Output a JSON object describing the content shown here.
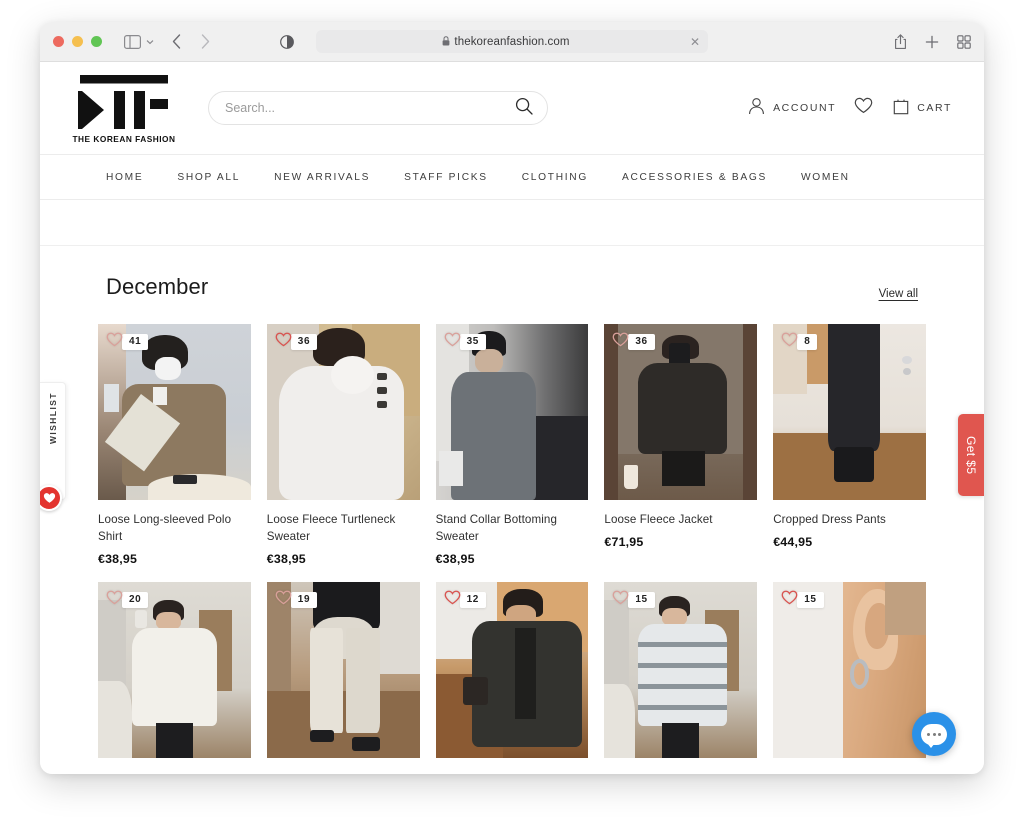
{
  "browser": {
    "traffic_lights": [
      "close",
      "minimize",
      "zoom"
    ],
    "url": "thekoreanfashion.com",
    "lock_icon": "lock-icon",
    "reader_icon": "reader-view-icon",
    "sidebar_icon": "sidebar-toggle-icon",
    "back_icon": "back-arrow-icon",
    "forward_icon": "forward-arrow-icon",
    "share_icon": "share-icon",
    "new_tab_icon": "plus-icon",
    "tab_overview_icon": "tab-grid-icon",
    "close_tab_icon": "close-icon"
  },
  "header": {
    "logo_text": "THE KOREAN FASHION",
    "logo_mark": "ktf-monogram-logo",
    "search": {
      "placeholder": "Search...",
      "value": "",
      "icon": "search-icon"
    },
    "account": {
      "label": "ACCOUNT",
      "icon": "user-icon"
    },
    "wishlist_icon": "heart-icon",
    "cart": {
      "label": "CART",
      "icon": "shopping-bag-icon"
    }
  },
  "nav": {
    "items": [
      {
        "label": "HOME"
      },
      {
        "label": "SHOP ALL"
      },
      {
        "label": "NEW ARRIVALS"
      },
      {
        "label": "STAFF PICKS"
      },
      {
        "label": "CLOTHING"
      },
      {
        "label": "ACCESSORIES & BAGS"
      },
      {
        "label": "WOMEN"
      }
    ]
  },
  "collection": {
    "title": "December",
    "view_all_label": "View all",
    "products": [
      {
        "title": "Loose Long-sleeved Polo Shirt",
        "price": "€38,95",
        "likes": "41",
        "scene": "polo-shirt-brown"
      },
      {
        "title": "Loose Fleece Turtleneck Sweater",
        "price": "€38,95",
        "likes": "36",
        "scene": "fleece-turtleneck-white"
      },
      {
        "title": "Stand Collar Bottoming Sweater",
        "price": "€38,95",
        "likes": "35",
        "scene": "stand-collar-grey"
      },
      {
        "title": "Loose Fleece Jacket",
        "price": "€71,95",
        "likes": "36",
        "scene": "fleece-jacket-black"
      },
      {
        "title": "Cropped Dress Pants",
        "price": "€44,95",
        "likes": "8",
        "scene": "cropped-pants-black"
      },
      {
        "title": "",
        "price": "",
        "likes": "20",
        "scene": "white-sweatshirt"
      },
      {
        "title": "",
        "price": "",
        "likes": "19",
        "scene": "cream-wide-pants"
      },
      {
        "title": "",
        "price": "",
        "likes": "12",
        "scene": "dark-puffer-jacket"
      },
      {
        "title": "",
        "price": "",
        "likes": "15",
        "scene": "plaid-puffer-jacket"
      },
      {
        "title": "",
        "price": "",
        "likes": "15",
        "scene": "hoop-earring"
      }
    ]
  },
  "widgets": {
    "wishlist_tab_label": "WISHLIST",
    "wishlist_tab_icon": "heart-icon",
    "get5_label": "Get $5",
    "chat_icon": "chat-bubble-icon"
  },
  "colors": {
    "accent_red": "#e3342f",
    "get5_red": "#e0564f",
    "chat_blue": "#2b91e8"
  }
}
